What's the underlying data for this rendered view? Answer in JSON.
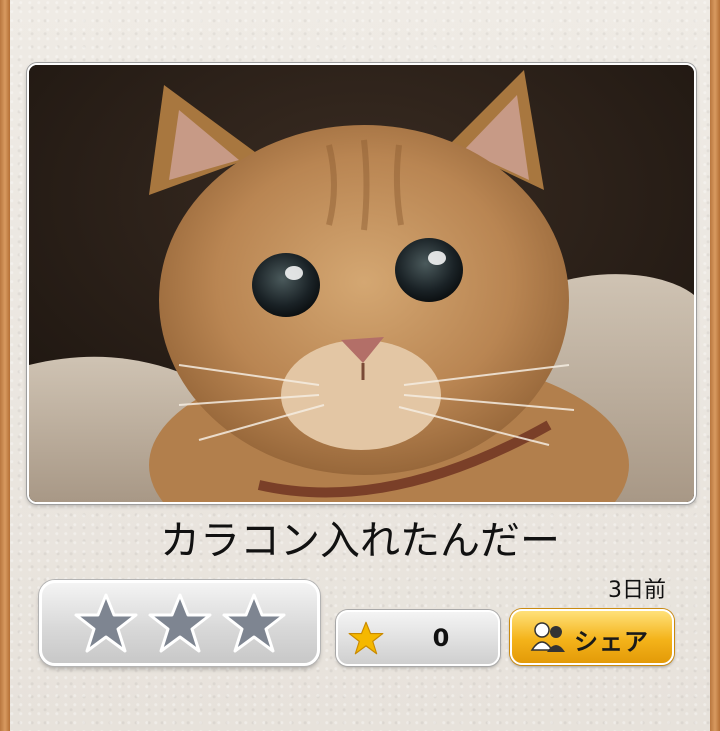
{
  "post": {
    "caption": "カラコン入れたんだー",
    "timestamp": "3日前",
    "photo_subject": "orange-tabby-cat-photo"
  },
  "rating": {
    "stars_total": 3,
    "stars_selected": 0
  },
  "favorites": {
    "count": "0",
    "icon": "gold-star-icon"
  },
  "share": {
    "label": "シェア",
    "icon": "share-people-icon"
  },
  "colors": {
    "share_button": "#f4b31a",
    "star_unselected": "#7e8591",
    "star_gold": "#f5b800"
  }
}
